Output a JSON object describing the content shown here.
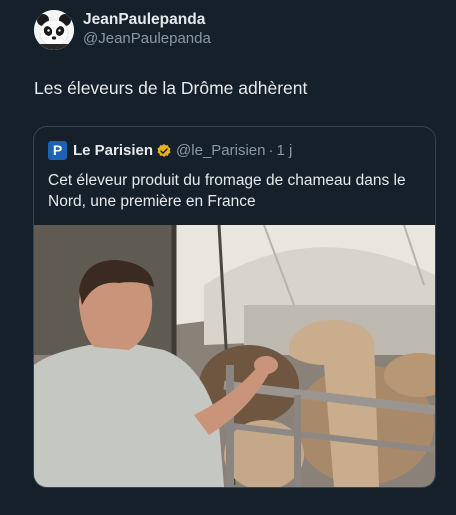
{
  "author": {
    "display_name": "JeanPaulepanda",
    "handle": "@JeanPaulepanda"
  },
  "tweet": {
    "text": "Les éleveurs de la Drôme adhèrent"
  },
  "quoted": {
    "logo_letter": "P",
    "name": "Le Parisien",
    "handle": "@le_Parisien",
    "separator": "·",
    "time": "1 j",
    "text": "Cet éleveur produit du fromage de chameau dans le Nord, une première en France",
    "brand_color": "#1d62b4",
    "badge_color": "#e8b317"
  },
  "colors": {
    "background": "#15202b",
    "text": "#e7e9ea",
    "muted": "#8b98a5",
    "border": "#38444d"
  },
  "icons": [
    "panda-avatar-icon",
    "verified-badge-icon"
  ]
}
